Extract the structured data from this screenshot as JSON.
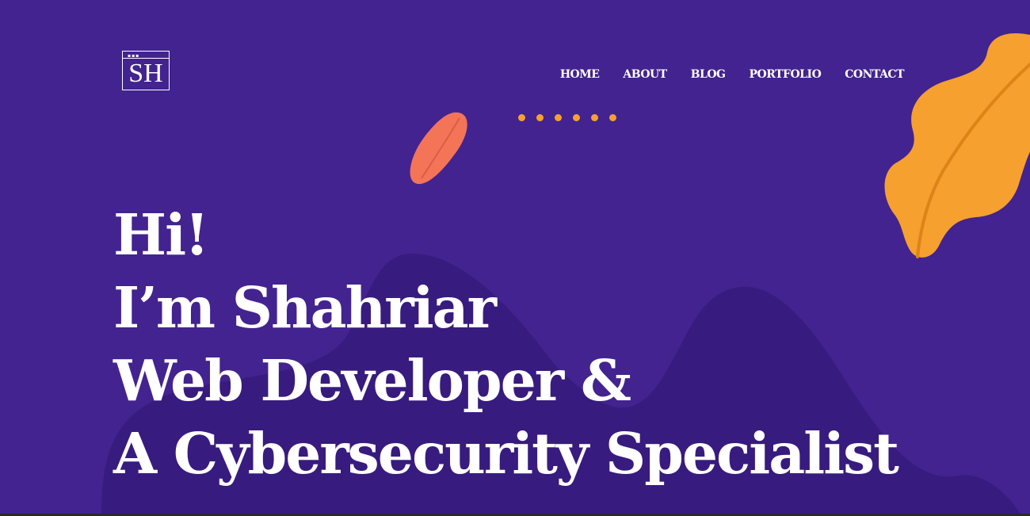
{
  "logo": {
    "text": "SH",
    "dots": "▪▪▪"
  },
  "nav": {
    "items": [
      {
        "label": "HOME"
      },
      {
        "label": "ABOUT"
      },
      {
        "label": "BLOG"
      },
      {
        "label": "PORTFOLIO"
      },
      {
        "label": "CONTACT"
      }
    ]
  },
  "hero": {
    "line1": "Hi!",
    "line2": "I’m Shahriar",
    "line3": "Web Developer &",
    "line4": "A Cybersecurity Specialist"
  },
  "colors": {
    "background": "#43238F",
    "blob": "#381B7E",
    "accent_orange": "#F6A030",
    "accent_coral": "#F47458",
    "text": "#FFFFFF"
  },
  "decor": {
    "dot_count": 6,
    "icons": [
      "orange-leaf-icon",
      "coral-leaf-icon"
    ]
  }
}
